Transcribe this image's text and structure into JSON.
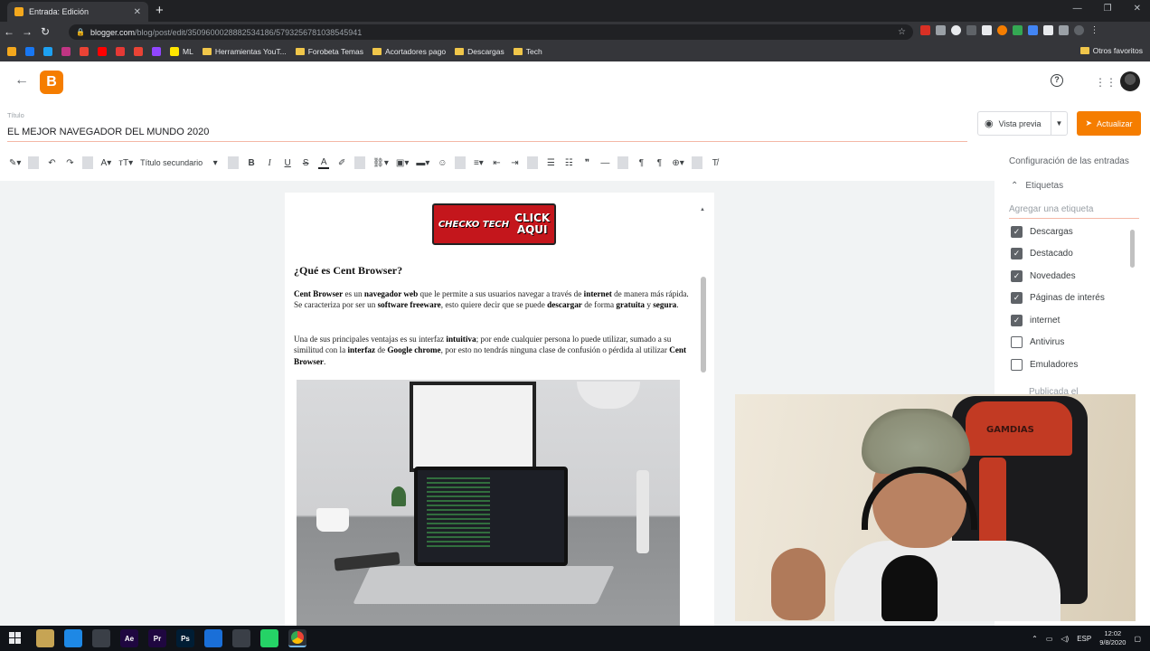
{
  "browser": {
    "tab_title": "Entrada: Edición",
    "tab_close": "✕",
    "new_tab": "+",
    "window_controls": [
      "—",
      "❐",
      "✕"
    ],
    "url_domain": "blogger.com",
    "url_path": "/blog/post/edit/3509600028882534186/5793256781038545941",
    "bookmarks": [
      {
        "label": "",
        "color": "#f4a81d"
      },
      {
        "label": "",
        "color": "#1877f2"
      },
      {
        "label": "",
        "color": "#1da1f2"
      },
      {
        "label": "",
        "color": "#c13584"
      },
      {
        "label": "",
        "color": "#ea4335"
      },
      {
        "label": "",
        "color": "#ff0000"
      },
      {
        "label": "",
        "color": "#e53935"
      },
      {
        "label": "",
        "color": "#ea4335"
      },
      {
        "label": "",
        "color": "#9146ff"
      },
      {
        "label": "ML",
        "color": "#ffe600"
      },
      {
        "label": "Herramientas YouT...",
        "folder": true
      },
      {
        "label": "Forobeta Temas",
        "folder": true
      },
      {
        "label": "Acortadores pago",
        "folder": true
      },
      {
        "label": "Descargas",
        "folder": true
      },
      {
        "label": "Tech",
        "folder": true
      }
    ],
    "other_bookmarks": "Otros favoritos"
  },
  "header": {
    "logo": "B",
    "help": "?",
    "apps": "⋮⋮⋮"
  },
  "post": {
    "title_label": "Título",
    "title": "EL MEJOR NAVEGADOR DEL MUNDO 2020",
    "preview_label": "Vista previa",
    "update_label": "Actualizar"
  },
  "toolbar": {
    "heading_select": "Título secundario"
  },
  "content": {
    "banner_left": "CHECKO TECH",
    "banner_right_1": "CLICK",
    "banner_right_2": "AQUI",
    "heading": "¿Qué es Cent Browser?",
    "p1": [
      {
        "t": "Cent Browser",
        "b": true
      },
      {
        "t": " es un ",
        "b": false
      },
      {
        "t": "navegador web",
        "b": true
      },
      {
        "t": " que le permite a sus usuarios navegar a través de ",
        "b": false
      },
      {
        "t": "internet",
        "b": true
      },
      {
        "t": " de manera más rápida. Se caracteriza por ser un ",
        "b": false
      },
      {
        "t": "software freeware",
        "b": true
      },
      {
        "t": ", esto quiere decir que se puede ",
        "b": false
      },
      {
        "t": "descargar",
        "b": true
      },
      {
        "t": " de forma ",
        "b": false
      },
      {
        "t": "gratuita",
        "b": true
      },
      {
        "t": " y ",
        "b": false
      },
      {
        "t": "segura",
        "b": true
      },
      {
        "t": ".",
        "b": false
      }
    ],
    "p2": [
      {
        "t": "Una de sus principales ventajas es su interfaz ",
        "b": false
      },
      {
        "t": "intuitiva",
        "b": true
      },
      {
        "t": "; por ende cualquier persona lo puede utilizar, sumado a su similitud con la ",
        "b": false
      },
      {
        "t": "interfaz",
        "b": true
      },
      {
        "t": " de ",
        "b": false
      },
      {
        "t": "Google chrome",
        "b": true
      },
      {
        "t": ", por esto no tendrás ninguna clase de confusión o pérdida al utilizar ",
        "b": false
      },
      {
        "t": "Cent Browser",
        "b": true
      },
      {
        "t": ".",
        "b": false
      }
    ]
  },
  "sidebar": {
    "title": "Configuración de las entradas",
    "section": "Etiquetas",
    "tag_placeholder": "Agregar una etiqueta",
    "labels": [
      {
        "name": "Descargas",
        "checked": true
      },
      {
        "name": "Destacado",
        "checked": true
      },
      {
        "name": "Novedades",
        "checked": true
      },
      {
        "name": "Páginas de interés",
        "checked": true
      },
      {
        "name": "internet",
        "checked": true
      },
      {
        "name": "Antivirus",
        "checked": false
      },
      {
        "name": "Emuladores",
        "checked": false
      }
    ],
    "published": "Publicada el"
  },
  "webcam": {
    "chair_brand": "GAMDIAS"
  },
  "taskbar": {
    "apps": [
      {
        "label": "",
        "color": "#c6a454",
        "name": "file-explorer"
      },
      {
        "label": "",
        "color": "#1e88e5",
        "name": "edge"
      },
      {
        "label": "",
        "color": "#3a3f47",
        "name": "chrome-gray"
      },
      {
        "label": "Ae",
        "color": "#1f0740",
        "name": "after-effects"
      },
      {
        "label": "Pr",
        "color": "#1f0740",
        "name": "premiere"
      },
      {
        "label": "Ps",
        "color": "#001d34",
        "name": "photoshop"
      },
      {
        "label": "",
        "color": "#1a6fd8",
        "name": "blue-app"
      },
      {
        "label": "",
        "color": "#3a3f47",
        "name": "app-dark"
      },
      {
        "label": "",
        "color": "#25d366",
        "name": "whatsapp"
      },
      {
        "label": "",
        "color": "#4285f4",
        "name": "chrome",
        "active": true
      }
    ],
    "lang": "ESP",
    "time": "12:02",
    "date": "9/8/2020"
  },
  "colors": {
    "accent": "#f57d00",
    "title_underline": "#f4b7a6"
  }
}
